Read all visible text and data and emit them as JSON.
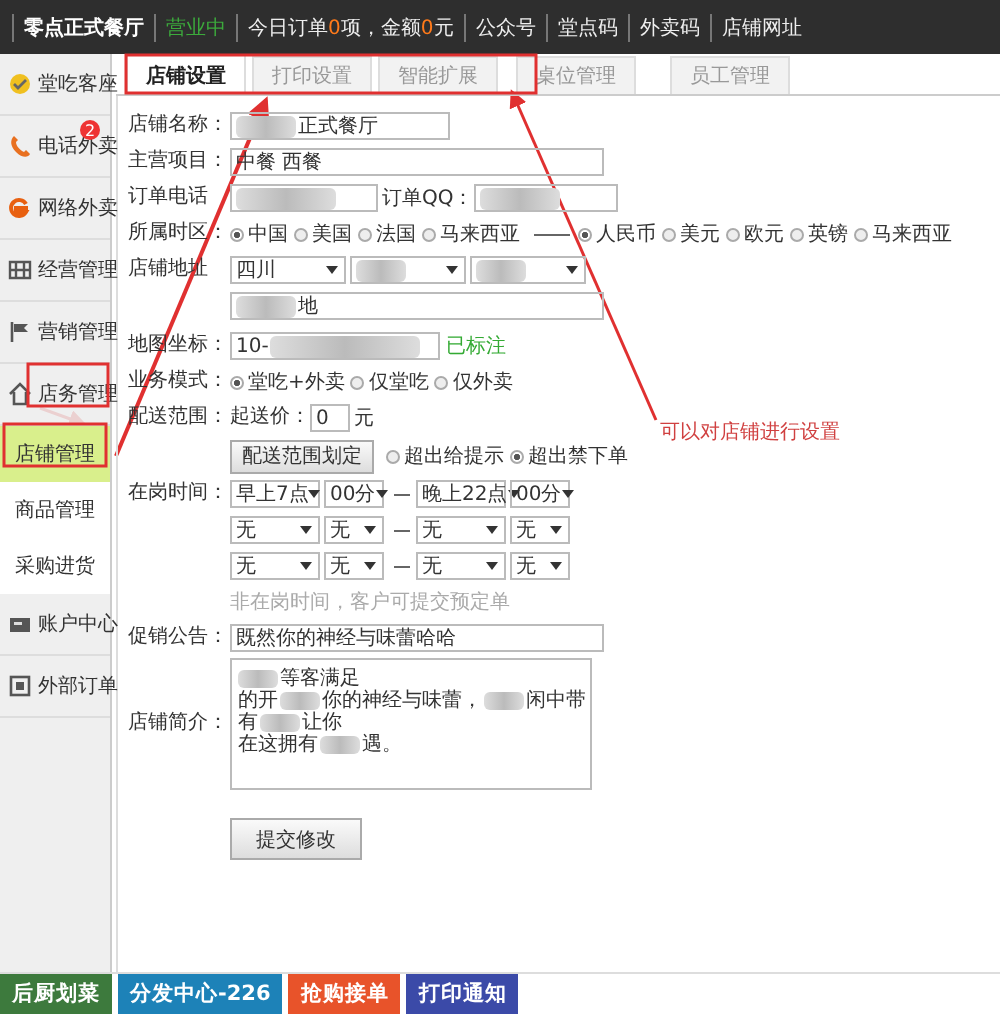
{
  "top_bar": {
    "items": [
      {
        "kind": "brand",
        "text": "零点正式餐厅"
      },
      {
        "kind": "status",
        "text": "营业中"
      },
      {
        "kind": "stats",
        "segments": [
          {
            "text": "今日订单",
            "highlight": false
          },
          {
            "text": "0",
            "highlight": true
          },
          {
            "text": "项，金额",
            "highlight": false
          },
          {
            "text": "0",
            "highlight": true
          },
          {
            "text": "元",
            "highlight": false
          }
        ]
      },
      {
        "kind": "link",
        "text": "公众号"
      },
      {
        "kind": "link",
        "text": "堂点码"
      },
      {
        "kind": "link",
        "text": "外卖码"
      },
      {
        "kind": "link",
        "text": "店铺网址"
      }
    ]
  },
  "sidebar": {
    "items": [
      {
        "label": "堂吃客座",
        "selected": false
      },
      {
        "label": "电话外卖",
        "badge": "2",
        "selected": false
      },
      {
        "label": "网络外卖",
        "selected": false
      },
      {
        "label": "经营管理",
        "selected": false
      },
      {
        "label": "营销管理",
        "selected": false
      },
      {
        "label": "店务管理",
        "selected": false,
        "expanded": true,
        "children": [
          {
            "label": "店铺管理",
            "selected": true
          },
          {
            "label": "商品管理",
            "selected": false
          },
          {
            "label": "采购进货",
            "selected": false
          }
        ]
      },
      {
        "label": "账户中心",
        "selected": false
      },
      {
        "label": "外部订单",
        "selected": false
      }
    ]
  },
  "tabs": [
    {
      "label": "店铺设置",
      "selected": true
    },
    {
      "label": "打印设置",
      "selected": false
    },
    {
      "label": "智能扩展",
      "selected": false
    },
    {
      "label": "桌位管理",
      "selected": false
    },
    {
      "label": "员工管理",
      "selected": false
    }
  ],
  "form": {
    "rows": [
      {
        "kind": "short_text",
        "label": "店铺名称：",
        "value": "正式餐厅",
        "blurred": true
      },
      {
        "kind": "wide_text",
        "label": "主营项目：",
        "value": "中餐 西餐",
        "blurred": false
      },
      {
        "kind": "pair",
        "label": "订单电话",
        "label_2": "订单QQ："
      },
      {
        "kind": "radios",
        "label": "所属时区：",
        "groups": [
          [
            {
              "label": "中国",
              "selected": true
            },
            {
              "label": "美国",
              "selected": false
            },
            {
              "label": "法国",
              "selected": false
            },
            {
              "label": "马来西亚",
              "selected": false
            }
          ],
          [
            {
              "label": "人民币",
              "selected": true
            },
            {
              "label": "美元",
              "selected": false
            },
            {
              "label": "欧元",
              "selected": false
            },
            {
              "label": "英镑",
              "selected": false
            },
            {
              "label": "马来西亚",
              "selected": false
            }
          ]
        ]
      },
      {
        "kind": "selects",
        "label": "店铺地址",
        "selects": [
          {
            "value": "四川",
            "blurred": false
          },
          {
            "blurred": true
          },
          {
            "blurred": true
          }
        ]
      },
      {
        "kind": "wide_text",
        "value": "地",
        "blurred": true
      },
      {
        "kind": "coords",
        "label": "地图坐标：",
        "value": "10-",
        "blurred": true,
        "status": "已标注"
      },
      {
        "kind": "radios",
        "label": "业务模式：",
        "groups": [
          [
            {
              "label": "堂吃+外卖",
              "selected": true
            },
            {
              "label": "仅堂吃",
              "selected": false
            },
            {
              "label": "仅外卖",
              "selected": false
            }
          ]
        ]
      },
      {
        "kind": "price",
        "label": "配送范围：",
        "prefix": "起送价：",
        "value": "0",
        "unit": "元"
      },
      {
        "kind": "button_radios",
        "button": "配送范围划定",
        "options": [
          {
            "label": "超出给提示",
            "selected": false
          },
          {
            "label": "超出禁下单",
            "selected": true
          }
        ]
      },
      {
        "kind": "times",
        "label": "在岗时间：",
        "values": [
          "早上7点",
          "00分",
          "晚上22点",
          "00分"
        ]
      },
      {
        "kind": "times",
        "values": [
          "无",
          "无",
          "无",
          "无"
        ]
      },
      {
        "kind": "times",
        "values": [
          "无",
          "无",
          "无",
          "无"
        ]
      },
      {
        "kind": "hint",
        "text": "非在岗时间，客户可提交预定单"
      },
      {
        "kind": "wide_text",
        "label": "促销公告：",
        "value": "既然你的神经与味蕾哈哈",
        "blurred": false
      },
      {
        "kind": "textarea",
        "label": "店铺简介：",
        "lines": [
          [
            {
              "kind": "blur"
            },
            {
              "kind": "text",
              "text": "等客满足"
            }
          ],
          [
            {
              "kind": "text",
              "text": "的开"
            },
            {
              "kind": "blur"
            },
            {
              "kind": "text",
              "text": "你的神经与味蕾，"
            },
            {
              "kind": "blur"
            },
            {
              "kind": "text",
              "text": "闲中带"
            }
          ],
          [
            {
              "kind": "text",
              "text": "有"
            },
            {
              "kind": "blur"
            },
            {
              "kind": "text",
              "text": "让你"
            }
          ],
          [
            {
              "kind": "text",
              "text": "在这拥有"
            },
            {
              "kind": "blur"
            },
            {
              "kind": "text",
              "text": "遇。"
            }
          ]
        ]
      },
      {
        "kind": "submit",
        "button": "提交修改"
      }
    ]
  },
  "annotation": {
    "note": "可以对店铺进行设置"
  },
  "bottom_bar": {
    "buttons": [
      {
        "label": "后厨划菜",
        "color": "#3d7a3d"
      },
      {
        "label": "分发中心-226",
        "color": "#1d82b8"
      },
      {
        "label": "抢购接单",
        "color": "#e8532a"
      },
      {
        "label": "打印通知",
        "color": "#3b4aa8"
      }
    ]
  }
}
